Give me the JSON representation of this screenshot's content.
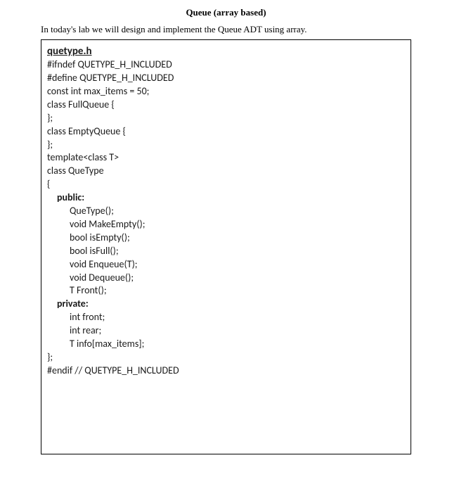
{
  "title": "Queue (array based)",
  "intro": "In today's lab we will design and implement the Queue ADT using array.",
  "filename": "quetype.h",
  "code": {
    "l1": "#ifndef QUETYPE_H_INCLUDED",
    "l2": "#define QUETYPE_H_INCLUDED",
    "l3": "const int max_items = 50;",
    "l4": "class FullQueue {",
    "l5": "};",
    "l6": "class EmptyQueue {",
    "l7": "};",
    "l8": "template<class T>",
    "l9": "class QueType",
    "l10": "{",
    "l11": "public:",
    "l12": "QueType();",
    "l13": "void MakeEmpty();",
    "l14": "bool isEmpty();",
    "l15": "bool isFull();",
    "l16": "void Enqueue(T);",
    "l17": "void Dequeue();",
    "l18": "T Front();",
    "l19": "private:",
    "l20": "int front;",
    "l21": "int rear;",
    "l22": "T info[max_items];",
    "l23": "};",
    "l24": "#endif // QUETYPE_H_INCLUDED"
  }
}
